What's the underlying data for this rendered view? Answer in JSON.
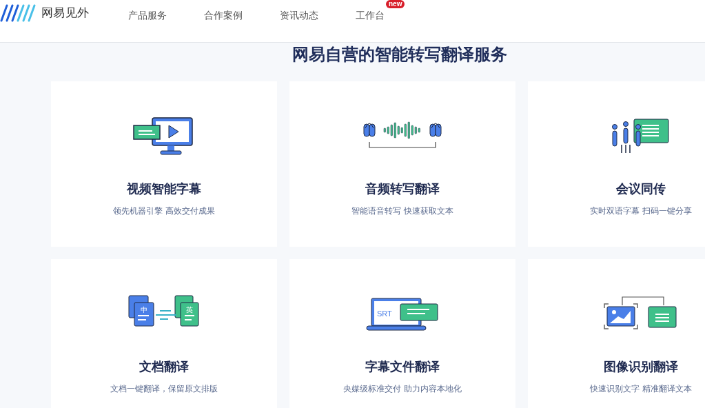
{
  "header": {
    "brand": "网易见外",
    "nav": [
      {
        "label": "产品服务"
      },
      {
        "label": "合作案例"
      },
      {
        "label": "资讯动态"
      },
      {
        "label": "工作台",
        "badge": "new"
      }
    ]
  },
  "section": {
    "title": "网易自营的智能转写翻译服务",
    "cards": [
      {
        "title": "视频智能字幕",
        "subtitle": "领先机器引擎 高效交付成果"
      },
      {
        "title": "音频转写翻译",
        "subtitle": "智能语音转写 快速获取文本"
      },
      {
        "title": "会议同传",
        "subtitle": "实时双语字幕 扫码一键分享"
      },
      {
        "title": "文档翻译",
        "subtitle": "文档一键翻译，保留原文排版",
        "icon_labels": [
          "中",
          "英"
        ]
      },
      {
        "title": "字幕文件翻译",
        "subtitle": "央媒级标准交付 助力内容本地化",
        "icon_labels": [
          "SRT"
        ]
      },
      {
        "title": "图像识别翻译",
        "subtitle": "快速识别文字 精准翻译文本"
      }
    ]
  }
}
